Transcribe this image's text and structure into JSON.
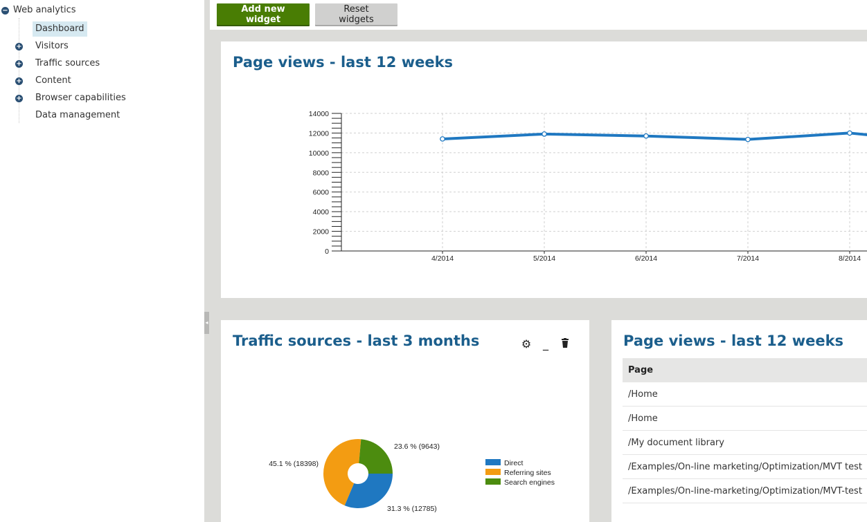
{
  "sidebar": {
    "root_label": "Web analytics",
    "items": [
      {
        "label": "Dashboard",
        "selected": true,
        "expandable": false
      },
      {
        "label": "Visitors",
        "selected": false,
        "expandable": true
      },
      {
        "label": "Traffic sources",
        "selected": false,
        "expandable": true
      },
      {
        "label": "Content",
        "selected": false,
        "expandable": true
      },
      {
        "label": "Browser capabilities",
        "selected": false,
        "expandable": true
      },
      {
        "label": "Data management",
        "selected": false,
        "expandable": false
      }
    ]
  },
  "toolbar": {
    "add_label": "Add new widget",
    "reset_label": "Reset widgets"
  },
  "widgets": {
    "line": {
      "title": "Page views - last 12 weeks"
    },
    "pie": {
      "title": "Traffic sources - last 3 months",
      "icons": [
        "gear-icon",
        "minimize-icon",
        "trash-icon"
      ]
    },
    "table": {
      "title": "Page views - last 12 weeks",
      "header": "Page",
      "rows": [
        "/Home",
        "/Home",
        "/My document library",
        "/Examples/On-line marketing/Optimization/MVT test",
        "/Examples/On-line-marketing/Optimization/MVT-test"
      ]
    }
  },
  "colors": {
    "accent": "#1b5e8c",
    "primary_button": "#497d04",
    "line": "#1f78c1",
    "direct": "#1f78c1",
    "referring": "#f39c12",
    "search": "#4c8c0f"
  },
  "chart_data": [
    {
      "type": "line",
      "title": "Page views - last 12 weeks",
      "categories": [
        "4/2014",
        "5/2014",
        "6/2014",
        "7/2014",
        "8/2014"
      ],
      "y_ticks": [
        0,
        2000,
        4000,
        6000,
        8000,
        10000,
        12000,
        14000
      ],
      "ylim": [
        0,
        14000
      ],
      "grid": true,
      "series": [
        {
          "values": [
            11400,
            11900,
            11700,
            11350,
            12000
          ]
        }
      ]
    },
    {
      "type": "pie",
      "title": "Traffic sources - last 3 months",
      "legend_position": "right",
      "slices": [
        {
          "name": "Direct",
          "value": 12785,
          "label": "31.3 % (12785)",
          "color": "#1f78c1"
        },
        {
          "name": "Referring sites",
          "value": 18398,
          "label": "45.1 % (18398)",
          "color": "#f39c12"
        },
        {
          "name": "Search engines",
          "value": 9643,
          "label": "23.6 % (9643)",
          "color": "#4c8c0f"
        }
      ]
    }
  ]
}
